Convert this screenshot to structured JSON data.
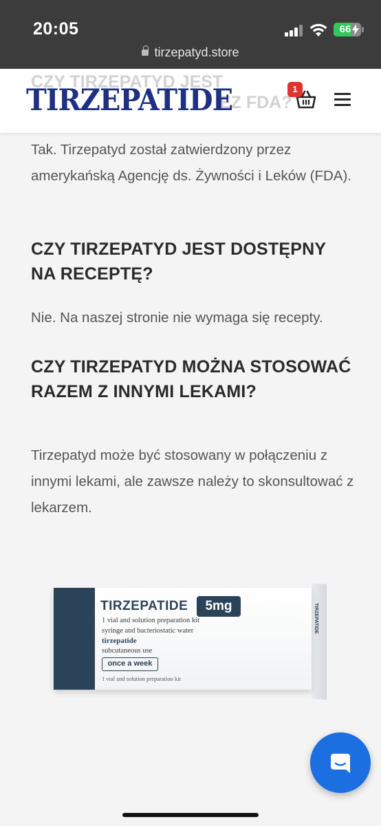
{
  "status_bar": {
    "time": "20:05",
    "battery": "66",
    "battery_level": 0.66,
    "cellular_bars_active": 3,
    "icons": [
      "cellular-signal-icon",
      "wifi-icon",
      "battery-charging-icon"
    ]
  },
  "browser": {
    "url": "tirzepatyd.store",
    "icons": [
      "lock-icon"
    ]
  },
  "header": {
    "logo": "TIRZEPATIDE",
    "scrolled_heading_line1": "CZY TIRZEPATYD JEST",
    "scrolled_heading_line2": "EZ FDA?",
    "cart_count": "1",
    "icons": [
      "cart-icon",
      "menu-icon"
    ]
  },
  "faq": [
    {
      "answer": "Tak. Tirzepatyd został zatwierdzony przez amerykańską Agencję ds. Żywności i Leków (FDA)."
    },
    {
      "question": "CZY TIRZEPATYD JEST DOSTĘPNY NA RECEPTĘ?",
      "answer": "Nie. Na naszej stronie nie wymaga się recepty."
    },
    {
      "question": "CZY TIRZEPATYD MOŻNA STOSOWAĆ RAZEM Z INNYMI LEKAMI?",
      "answer": "Tirzepatyd może być stosowany w połączeniu z innymi lekami, ale zawsze należy to skonsultować z lekarzem."
    }
  ],
  "product_image": {
    "brand": "TIRZEPATIDE",
    "dose": "5mg",
    "line1": "1 vial and solution preparation kit",
    "line2": "syringe and bacteriostatic water",
    "line3": "tirzepatide",
    "line4": "subcutaneous use",
    "frequency": "once a week",
    "footer": "1 vial and solution preparation kit",
    "side_label": "TIRZEPATIDE"
  },
  "chat": {
    "icons": [
      "chat-bubble-icon"
    ]
  },
  "colors": {
    "status_bar_bg": "#3c3c3c",
    "logo": "#1e2f84",
    "badge": "#e0332d",
    "chat_button": "#1b6fe0",
    "box_accent": "#2b4359"
  }
}
